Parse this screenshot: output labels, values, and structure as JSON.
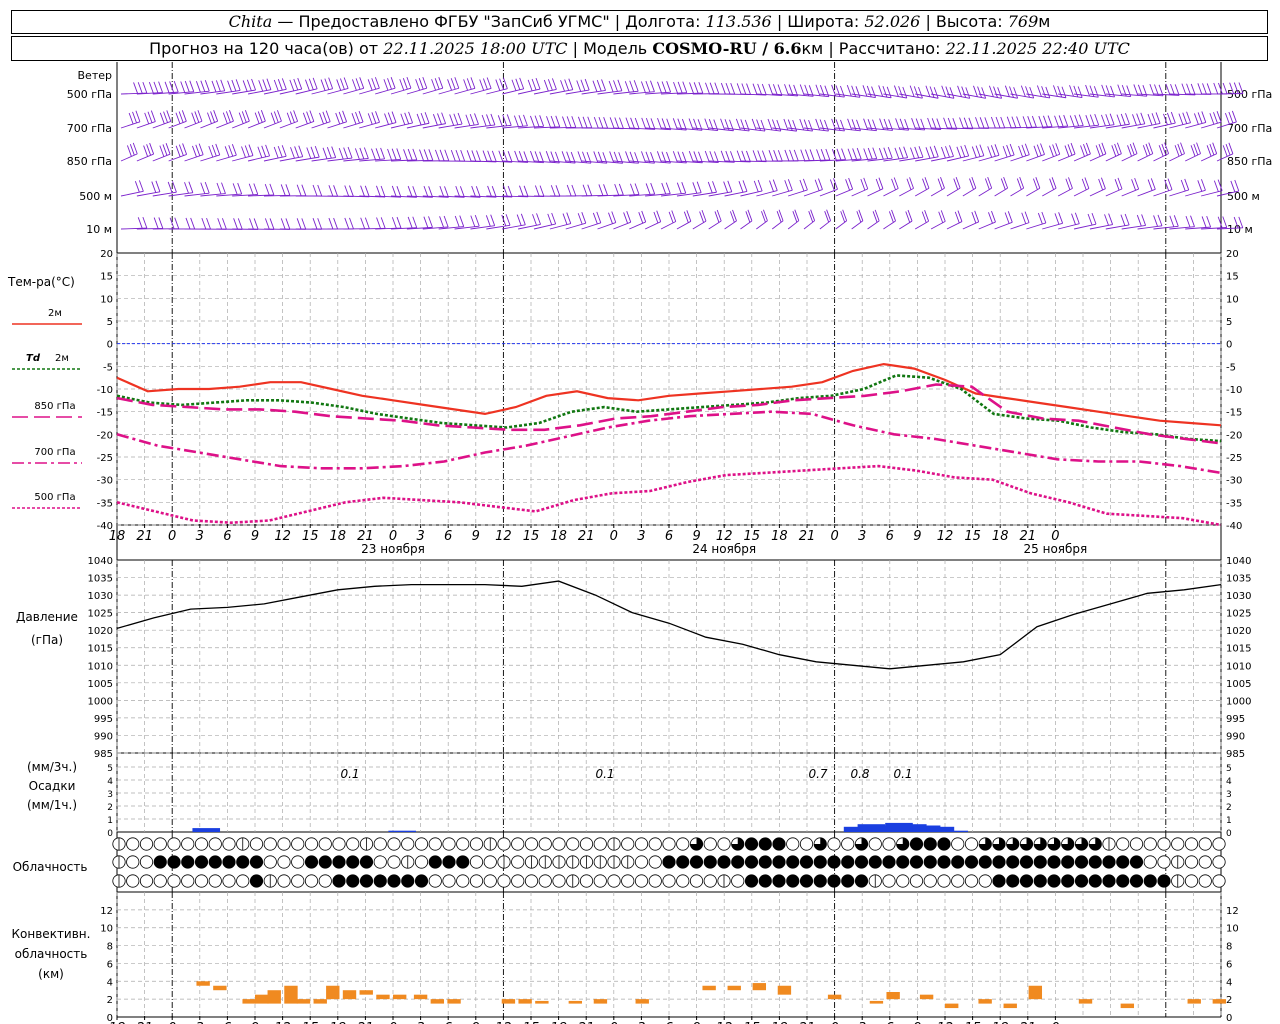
{
  "header": {
    "station": "Chita",
    "provider": "— Предоставлено ФГБУ \"ЗапСиб УГМС\" | Долгота:",
    "lon": "113.536",
    "lat_label": "| Широта:",
    "lat": "52.026",
    "alt_label": "| Высота:",
    "alt": "769",
    "alt_unit": "м",
    "forecast_label": "Прогноз на 120 часа(ов) от",
    "forecast_start": "22.11.2025 18:00 UTC",
    "model_label": "| Модель",
    "model": "COSMO-RU / 6.6",
    "model_unit": "км",
    "calc_label": "| Рассчитано:",
    "calc_time": "22.11.2025 22:40 UTC"
  },
  "colors": {
    "wind": "#7b22cc",
    "t2m": "#ee3322",
    "td2m": "#117711",
    "t850": "#dd1188",
    "t700": "#dd1188",
    "t500": "#dd1188",
    "zero_line": "#2233ee",
    "precip": "#1a3fe0",
    "convective": "#f08a20"
  },
  "chart_data": [
    {
      "type": "wind-barbs",
      "title": "Ветер",
      "levels": [
        "500 гПа",
        "700 гПа",
        "850 гПа",
        "500 м",
        "10 м"
      ]
    },
    {
      "type": "line",
      "ylabel": "Тем-ра(°С)",
      "ylim": [
        -40,
        20
      ],
      "yticks": [
        20,
        15,
        10,
        5,
        0,
        -5,
        -10,
        -15,
        -20,
        -25,
        -30,
        -35,
        -40
      ],
      "x_hours": [
        0,
        3,
        6,
        9,
        12,
        15,
        18,
        21,
        24,
        27,
        30,
        33,
        36,
        39,
        42,
        45,
        48,
        51,
        54,
        57,
        60,
        63,
        66,
        69,
        72,
        75,
        78,
        81,
        84,
        87,
        90,
        93,
        96,
        99,
        102,
        105,
        108,
        111,
        114,
        117,
        120
      ],
      "series": [
        {
          "name": "2м",
          "style": "solid",
          "values": [
            -7.5,
            -10.5,
            -10,
            -10,
            -9.5,
            -8.5,
            -8.5,
            -10,
            -11.5,
            -12.5,
            -13.5,
            -14.5,
            -15.5,
            -14,
            -11.5,
            -10.5,
            -12,
            -12.5,
            -11.5,
            -11,
            -10.5,
            -10,
            -9.5,
            -8.5,
            -6,
            -4.5,
            -5.5,
            -8,
            -11,
            -12,
            -13,
            -14,
            -15,
            -16,
            -17,
            -17.5,
            -18
          ]
        },
        {
          "name": "Td 2м",
          "style": "dotted",
          "values": [
            -11.5,
            -13,
            -13.5,
            -13,
            -12.5,
            -12.5,
            -13,
            -14,
            -15.5,
            -16.5,
            -17.5,
            -18,
            -18.5,
            -17.5,
            -15,
            -14,
            -15,
            -14.5,
            -14,
            -13.5,
            -13,
            -12,
            -11.5,
            -10,
            -7,
            -7.5,
            -10,
            -15.5,
            -16.5,
            -17,
            -18.5,
            -19.5,
            -20,
            -21,
            -21.5
          ]
        },
        {
          "name": "850 гПа",
          "style": "longdash",
          "values": [
            -12,
            -13.5,
            -14,
            -14.5,
            -14.5,
            -15,
            -16,
            -16.5,
            -17,
            -18,
            -18.5,
            -19,
            -19,
            -18,
            -16.5,
            -16,
            -15,
            -14,
            -13.5,
            -12.5,
            -12,
            -11.5,
            -10.5,
            -9,
            -9.5,
            -15,
            -16.5,
            -17,
            -18.5,
            -20,
            -21,
            -22
          ]
        },
        {
          "name": "700 гПа",
          "style": "dashdot",
          "values": [
            -20,
            -22.5,
            -24,
            -25.5,
            -27,
            -27.5,
            -27.5,
            -27,
            -26,
            -24,
            -22.5,
            -20.5,
            -18.5,
            -17,
            -16,
            -15.5,
            -15,
            -15.5,
            -18,
            -20,
            -21,
            -22.5,
            -24,
            -25.5,
            -26,
            -26,
            -27,
            -28.5
          ]
        },
        {
          "name": "500 гПа",
          "style": "dotted",
          "values": [
            -35,
            -37,
            -39,
            -39.5,
            -39,
            -37,
            -35,
            -34,
            -34.5,
            -35,
            -36,
            -37,
            -34.5,
            -33,
            -32.5,
            -30.5,
            -29,
            -28.5,
            -28,
            -27.5,
            -27,
            -28,
            -29.5,
            -30,
            -33,
            -35,
            -37.5,
            -38,
            -38.5,
            -40
          ]
        }
      ]
    },
    {
      "type": "line",
      "ylabel": "Давление",
      "yunit": "(гПа)",
      "ylim": [
        985,
        1040
      ],
      "yticks": [
        1040,
        1035,
        1030,
        1025,
        1020,
        1015,
        1010,
        1005,
        1000,
        995,
        990,
        985
      ],
      "series": [
        {
          "name": "",
          "values": [
            1020.5,
            1023.5,
            1026,
            1026.5,
            1027.5,
            1029.5,
            1031.5,
            1032.5,
            1033,
            1033,
            1033,
            1032.5,
            1034,
            1030,
            1025,
            1022,
            1018,
            1016,
            1013,
            1011,
            1010,
            1009,
            1010,
            1011,
            1013,
            1021,
            1024.5,
            1027.5,
            1030.5,
            1031.5,
            1033
          ]
        }
      ]
    },
    {
      "type": "bar",
      "ylabel": "(мм/3ч.)",
      "ylabel2": "Осадки",
      "ylabel3": "(мм/1ч.)",
      "ylim": [
        0,
        5
      ],
      "yticks": [
        5,
        4,
        3,
        2,
        1,
        0
      ],
      "labels": [
        "0.1",
        "0.1",
        "0.7",
        "0.8",
        "0.1"
      ],
      "values": [
        0.1,
        0.1,
        0.7,
        0.8,
        0.1
      ]
    },
    {
      "type": "table",
      "title": "Облачность",
      "rows": 3
    },
    {
      "type": "bar",
      "ylabel": "Конвективн.",
      "ylabel2": "облачность",
      "ylabel3": "(км)",
      "ylim": [
        0,
        14
      ],
      "yticks": [
        12,
        10,
        8,
        6,
        4,
        2,
        0
      ]
    }
  ],
  "time_axis": {
    "ticks": [
      "18",
      "21",
      "0",
      "3",
      "6",
      "9",
      "12",
      "15",
      "18",
      "21",
      "0",
      "3",
      "6",
      "9",
      "12",
      "15",
      "18",
      "21",
      "0",
      "3",
      "6",
      "9",
      "12",
      "15",
      "18",
      "21",
      "0",
      "3",
      "6",
      "9",
      "12",
      "15",
      "18",
      "21",
      "0"
    ],
    "days": [
      "23 ноября",
      "24 ноября",
      "25 ноября"
    ]
  },
  "legend": {
    "t2m_label": "2м",
    "td_label": "Td",
    "td_suffix": "2м",
    "t850_label": "850 гПа",
    "t700_label": "700 гПа",
    "t500_label": "500 гПа"
  }
}
